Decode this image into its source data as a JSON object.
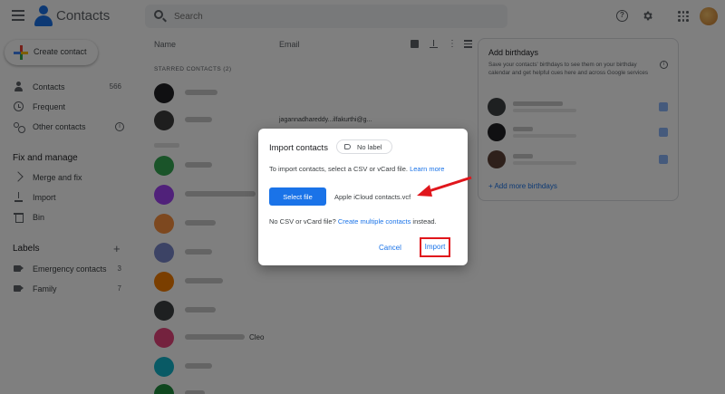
{
  "header": {
    "app_title": "Contacts",
    "search_placeholder": "Search"
  },
  "sidebar": {
    "create_label": "Create contact",
    "items": [
      {
        "label": "Contacts",
        "count": "566"
      },
      {
        "label": "Frequent",
        "count": ""
      },
      {
        "label": "Other contacts",
        "count": ""
      }
    ],
    "fix_manage_title": "Fix and manage",
    "fix_items": [
      {
        "label": "Merge and fix"
      },
      {
        "label": "Import"
      },
      {
        "label": "Bin"
      }
    ],
    "labels_title": "Labels",
    "label_items": [
      {
        "label": "Emergency contacts",
        "count": "3"
      },
      {
        "label": "Family",
        "count": "7"
      }
    ]
  },
  "list": {
    "col_name": "Name",
    "col_email": "Email",
    "starred_header": "STARRED CONTACTS (2)",
    "email_visible": "jagannadhareddy...ilfakurthi@g...",
    "row_suffix": "Cleo"
  },
  "birthdays": {
    "title": "Add birthdays",
    "description": "Save your contacts' birthdays to see them on your birthday calendar and get helpful cues here and across Google services",
    "add_more": "Add more birthdays"
  },
  "dialog": {
    "title": "Import contacts",
    "chip_label": "No label",
    "instruction": "To import contacts, select a CSV or vCard file.",
    "learn_more": "Learn more",
    "select_file": "Select file",
    "filename": "Apple iCloud contacts.vcf",
    "no_csv_prefix": "No CSV or vCard file?",
    "create_multiple": "Create multiple contacts",
    "no_csv_suffix": "instead.",
    "cancel": "Cancel",
    "import": "Import"
  },
  "colors": {
    "accent": "#1a73e8",
    "annotation_red": "#e0161c"
  }
}
